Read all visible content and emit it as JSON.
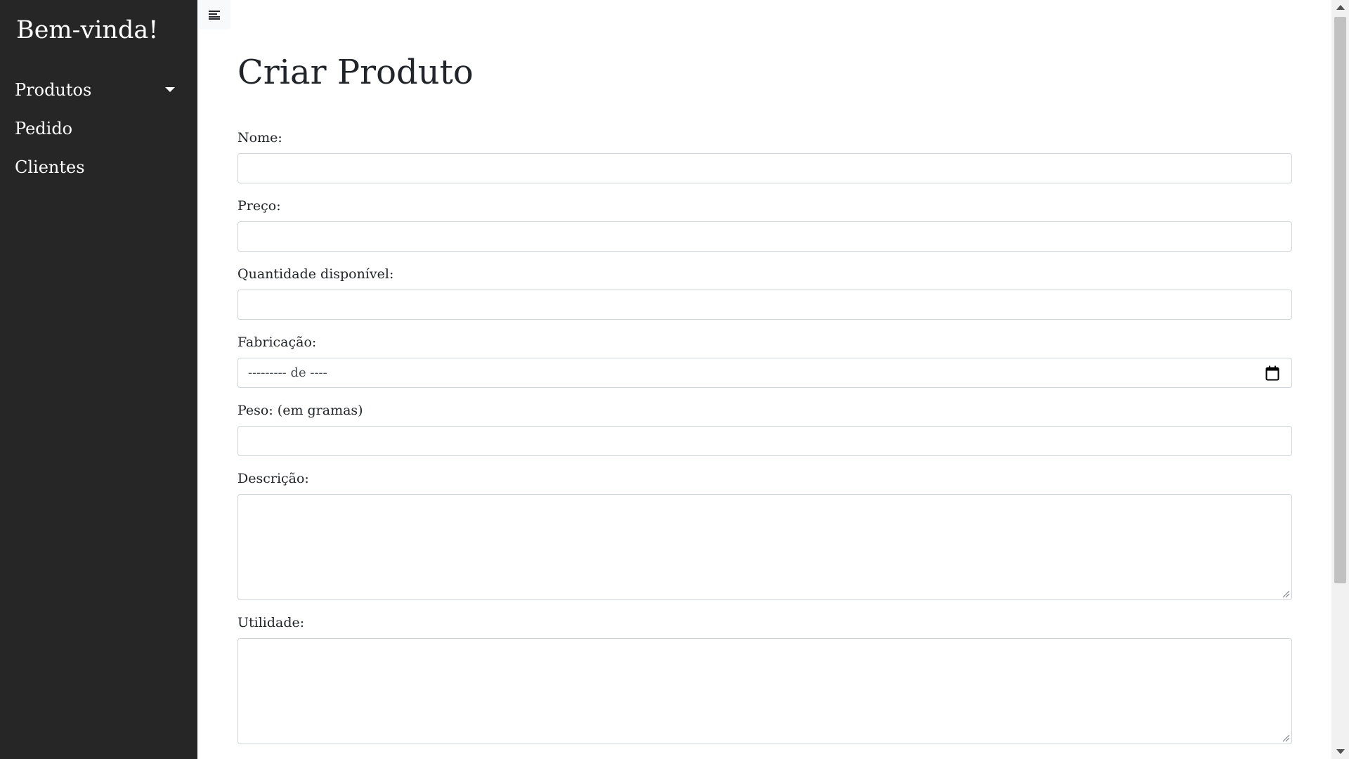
{
  "sidebar": {
    "brand": "Bem-vinda!",
    "items": [
      {
        "label": "Produtos",
        "has_dropdown": true
      },
      {
        "label": "Pedido"
      },
      {
        "label": "Clientes"
      }
    ]
  },
  "toggle": {
    "icon": "menu-lines-icon"
  },
  "page": {
    "title": "Criar Produto"
  },
  "form": {
    "nome": {
      "label": "Nome:",
      "value": ""
    },
    "preco": {
      "label": "Preço:",
      "value": ""
    },
    "quantidade": {
      "label": "Quantidade disponível:",
      "value": ""
    },
    "fabricacao": {
      "label": "Fabricação:",
      "placeholder": "--------- de ----",
      "icon": "calendar-icon"
    },
    "peso": {
      "label": "Peso: (em gramas)",
      "value": ""
    },
    "descricao": {
      "label": "Descrição:",
      "value": ""
    },
    "utilidade": {
      "label": "Utilidade:",
      "value": ""
    }
  },
  "colors": {
    "sidebar_bg": "#262626",
    "page_bg": "#ffffff",
    "input_border": "#ced4da"
  }
}
